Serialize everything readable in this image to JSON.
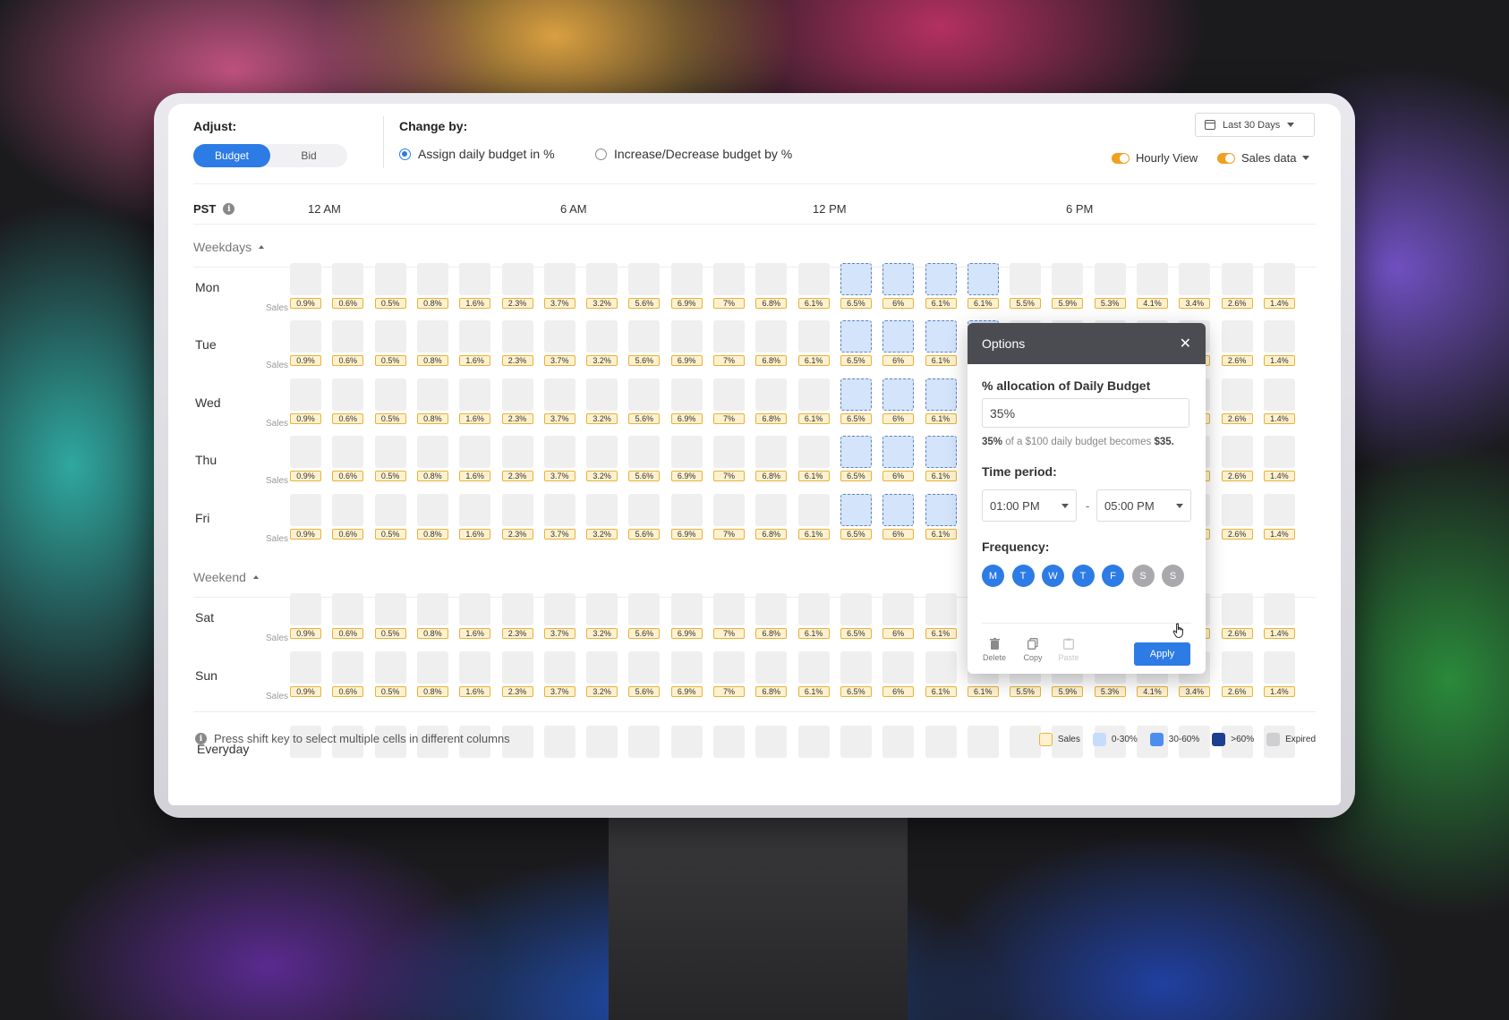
{
  "header": {
    "adjust_label": "Adjust:",
    "segments": [
      "Budget",
      "Bid"
    ],
    "active_segment": "Budget",
    "change_by_label": "Change by:",
    "options": [
      {
        "label": "Assign daily budget in %",
        "selected": true
      },
      {
        "label": "Increase/Decrease budget by %",
        "selected": false
      }
    ],
    "date_range": "Last 30 Days",
    "toggles": [
      {
        "label": "Hourly View",
        "on": true
      },
      {
        "label": "Sales data",
        "on": true
      }
    ]
  },
  "timeline": {
    "timezone": "PST",
    "labels": [
      "12 AM",
      "6 AM",
      "12 PM",
      "6 PM"
    ]
  },
  "groups": {
    "weekdays": "Weekdays",
    "weekend": "Weekend",
    "everyday": "Everyday"
  },
  "sales_label": "Sales",
  "days": [
    {
      "name": "Mon",
      "group": "weekdays",
      "selected_hours": [
        13,
        14,
        15,
        16
      ]
    },
    {
      "name": "Tue",
      "group": "weekdays",
      "selected_hours": [
        13,
        14,
        15,
        16
      ]
    },
    {
      "name": "Wed",
      "group": "weekdays",
      "selected_hours": [
        13,
        14,
        15,
        16
      ]
    },
    {
      "name": "Thu",
      "group": "weekdays",
      "selected_hours": [
        13,
        14,
        15,
        16
      ]
    },
    {
      "name": "Fri",
      "group": "weekdays",
      "selected_hours": [
        13,
        14,
        15,
        16
      ]
    },
    {
      "name": "Sat",
      "group": "weekend",
      "selected_hours": []
    },
    {
      "name": "Sun",
      "group": "weekend",
      "selected_hours": []
    }
  ],
  "hourly_sales": [
    "0.9%",
    "0.6%",
    "0.5%",
    "0.8%",
    "1.6%",
    "2.3%",
    "3.7%",
    "3.2%",
    "5.6%",
    "6.9%",
    "7%",
    "6.8%",
    "6.1%",
    "6.5%",
    "6%",
    "6.1%",
    "6.1%",
    "5.5%",
    "5.9%",
    "5.3%",
    "4.1%",
    "3.4%",
    "2.6%",
    "1.4%"
  ],
  "footer": {
    "note": "Press shift key to select multiple cells in different columns",
    "legend": [
      {
        "label": "Sales",
        "color": "#fdf1cf",
        "border": "#e8b238"
      },
      {
        "label": "0-30%",
        "color": "#c6dcfb",
        "border": "#c6dcfb"
      },
      {
        "label": "30-60%",
        "color": "#4c8ef0",
        "border": "#4c8ef0"
      },
      {
        "label": ">60%",
        "color": "#1d3f8f",
        "border": "#1d3f8f"
      },
      {
        "label": "Expired",
        "color": "#cfcfd2",
        "border": "#cfcfd2"
      }
    ]
  },
  "options_panel": {
    "title": "Options",
    "allocation_label": "% allocation of Daily Budget",
    "allocation_value": "35%",
    "hint_pct": "35%",
    "hint_text": "of a $100 daily budget becomes",
    "hint_amount": "$35.",
    "time_period_label": "Time period:",
    "start_time": "01:00 PM",
    "end_time": "05:00 PM",
    "separator": "-",
    "frequency_label": "Frequency:",
    "frequency": [
      {
        "day": "M",
        "on": true
      },
      {
        "day": "T",
        "on": true
      },
      {
        "day": "W",
        "on": true
      },
      {
        "day": "T",
        "on": true
      },
      {
        "day": "F",
        "on": true
      },
      {
        "day": "S",
        "on": false
      },
      {
        "day": "S",
        "on": false
      }
    ],
    "tools": [
      "Delete",
      "Copy",
      "Paste"
    ],
    "apply_label": "Apply"
  },
  "colors": {
    "accent": "#2d7be5",
    "selected_cell": "#d3e4fb",
    "sales_badge": "#fdf1cf",
    "panel_header": "#4b4c52"
  }
}
